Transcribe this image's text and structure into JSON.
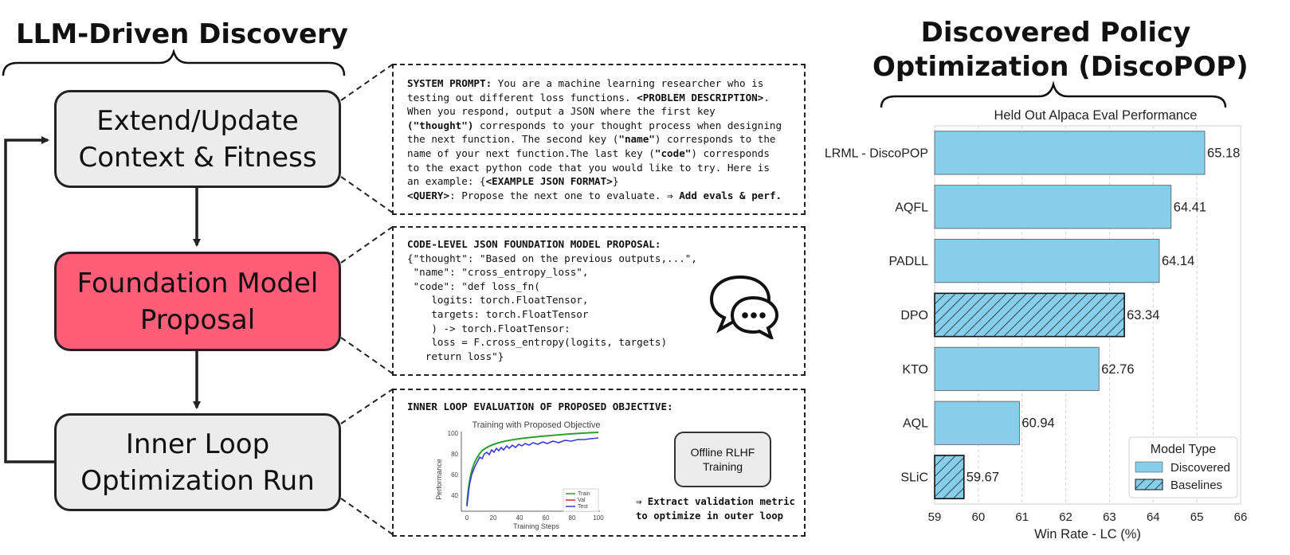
{
  "left_section": {
    "title": "LLM-Driven Discovery",
    "steps": [
      {
        "line1": "Extend/Update",
        "line2": "Context & Fitness"
      },
      {
        "line1": "Foundation Model",
        "line2": "Proposal"
      },
      {
        "line1": "Inner Loop",
        "line2": "Optimization Run"
      }
    ]
  },
  "panels": {
    "system_prompt": {
      "label": "SYSTEM PROMPT:",
      "text1": " You are a machine learning researcher who is",
      "text2": "testing out different loss functions. ",
      "problem_tag": "<PROBLEM DESCRIPTION>",
      "text3": ".",
      "text4": "When you respond, output a JSON where the first key",
      "thought_key": "(\"thought\")",
      "text5": " corresponds to your thought process when designing",
      "text6": "the next function. The second key (",
      "name_key": "\"name\"",
      "text7": ") corresponds to the",
      "text8": "name of your next function.The last key (",
      "code_key": "\"code\"",
      "text9": ") corresponds",
      "text10": "to the exact python code that you would like to try. Here is",
      "text11": "an example: {",
      "example_tag": "<EXAMPLE JSON FORMAT>",
      "text12": "}",
      "query_tag": "<QUERY>",
      "query_text": ": Propose the next one to evaluate. ",
      "query_action": "⇒ Add evals & perf."
    },
    "proposal": {
      "heading": "CODE-LEVEL JSON FOUNDATION MODEL PROPOSAL:",
      "code_lines": [
        "{\"thought\": \"Based on the previous outputs,...\",",
        " \"name\": \"cross_entropy_loss\",",
        " \"code\": \"def loss_fn(",
        "    logits: torch.FloatTensor,",
        "    targets: torch.FloatTensor",
        "    ) -> torch.FloatTensor:",
        "    loss = F.cross_entropy(logits, targets)",
        "   return loss\"}"
      ]
    },
    "inner_loop": {
      "heading": "INNER LOOP EVALUATION OF PROPOSED OBJECTIVE:",
      "box_line1": "Offline RLHF",
      "box_line2": "Training",
      "extract_line1": "⇒ Extract validation metric",
      "extract_line2": "to optimize in outer loop",
      "mini_chart": {
        "title": "Training with Proposed Objective",
        "xlabel": "Training Steps",
        "ylabel": "Performance",
        "xticks": [
          "0",
          "20",
          "40",
          "60",
          "80",
          "100"
        ],
        "yticks": [
          "40",
          "60",
          "80",
          "100"
        ],
        "legend": [
          "Train",
          "Val",
          "Test"
        ],
        "colors": [
          "#2ca02c",
          "#d62728",
          "#3b3bd8"
        ]
      }
    }
  },
  "right_section": {
    "title_line1": "Discovered Policy",
    "title_line2": "Optimization (DiscoPOP)"
  },
  "chart_data": {
    "type": "bar",
    "orientation": "horizontal",
    "title": "Held Out Alpaca Eval Performance",
    "xlabel": "Win Rate - LC (%)",
    "ylabel": "",
    "xlim": [
      59,
      66
    ],
    "xticks": [
      59,
      60,
      61,
      62,
      63,
      64,
      65,
      66
    ],
    "categories": [
      "LRML - DiscoPOP",
      "AQFL",
      "PADLL",
      "DPO",
      "KTO",
      "AQL",
      "SLiC"
    ],
    "values": [
      65.18,
      64.41,
      64.14,
      63.34,
      62.76,
      60.94,
      59.67
    ],
    "value_labels": [
      "65.18",
      "64.41",
      "64.14",
      "63.34",
      "62.76",
      "60.94",
      "59.67"
    ],
    "types": [
      "Discovered",
      "Discovered",
      "Discovered",
      "Baselines",
      "Discovered",
      "Discovered",
      "Baselines"
    ],
    "legend_title": "Model Type",
    "legend": [
      "Discovered",
      "Baselines"
    ],
    "legend_position": "bottom-right",
    "grid": true,
    "colors": {
      "discovered": "#87ceeb",
      "baseline": "#87ceeb",
      "edge": "#555555"
    }
  }
}
